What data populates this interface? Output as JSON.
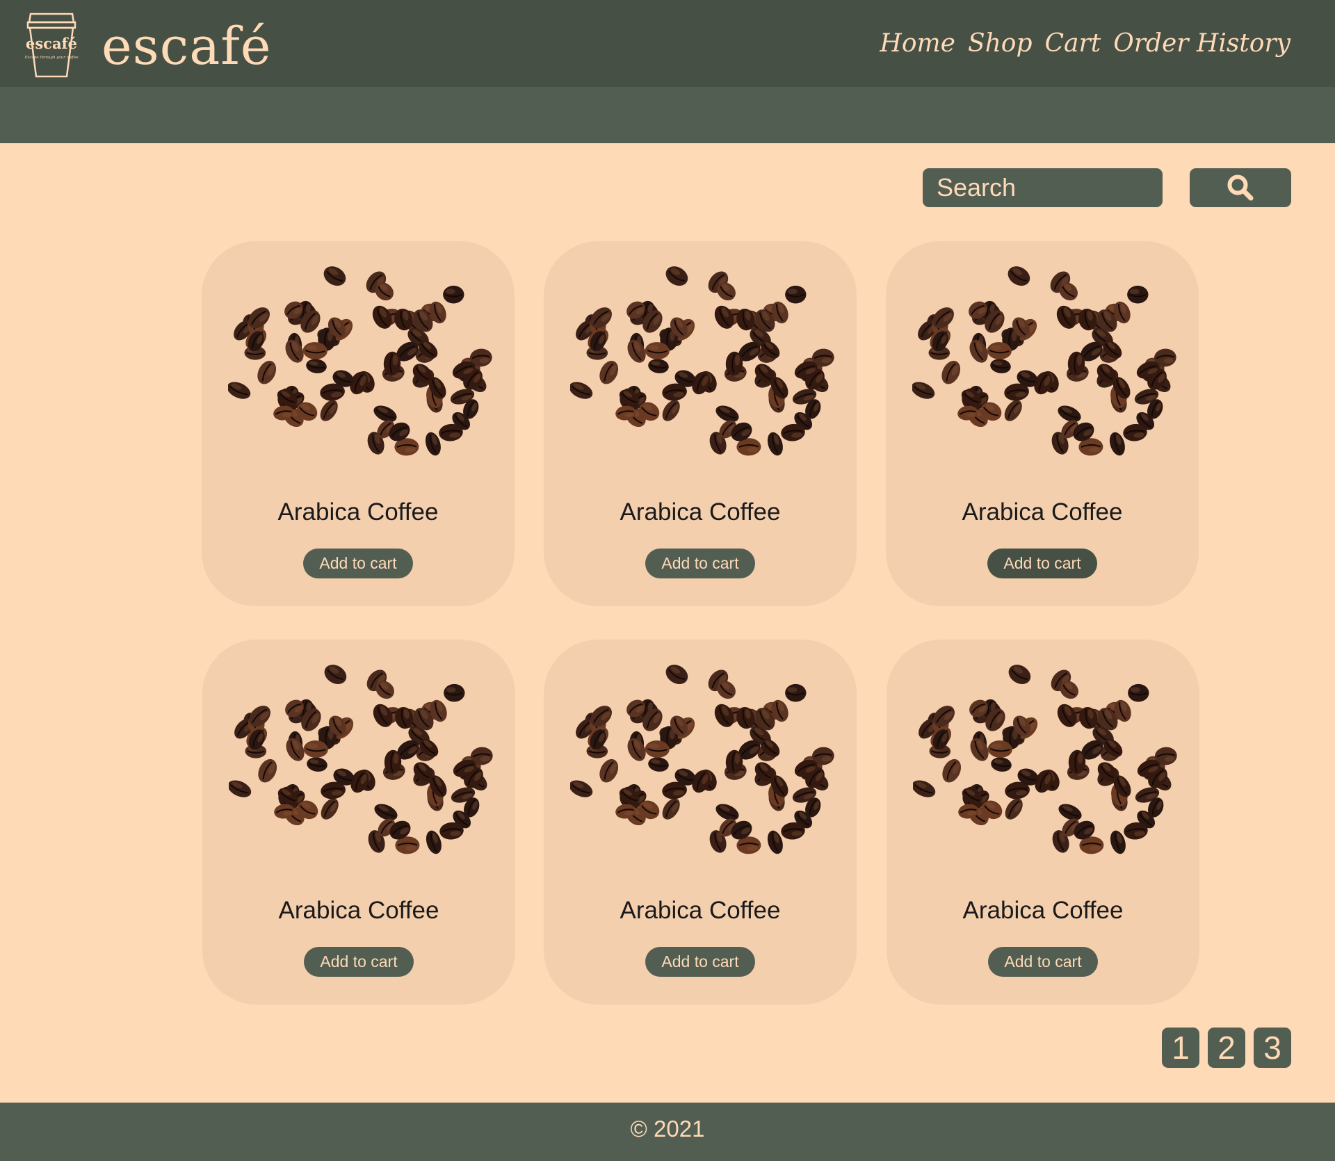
{
  "header": {
    "logo_text": "escafé",
    "logo_tagline": "Escape through your coffee",
    "brand": "escafé",
    "nav": [
      "Home",
      "Shop",
      "Cart",
      "Order History"
    ]
  },
  "search": {
    "placeholder": "Search",
    "value": "",
    "icon": "search-icon"
  },
  "products": [
    {
      "name": "Arabica Coffee",
      "button": "Add to cart",
      "image": "coffee-beans-image"
    },
    {
      "name": "Arabica Coffee",
      "button": "Add to cart",
      "image": "coffee-beans-image"
    },
    {
      "name": "Arabica Coffee",
      "button": "Add to cart",
      "image": "coffee-beans-image"
    },
    {
      "name": "Arabica Coffee",
      "button": "Add to cart",
      "image": "coffee-beans-image"
    },
    {
      "name": "Arabica Coffee",
      "button": "Add to cart",
      "image": "coffee-beans-image"
    },
    {
      "name": "Arabica Coffee",
      "button": "Add to cart",
      "image": "coffee-beans-image"
    }
  ],
  "pagination": [
    "1",
    "2",
    "3"
  ],
  "footer": {
    "text": "© 2021"
  },
  "colors": {
    "background": "#fedab7",
    "header": "#465045",
    "subheader": "#535e52",
    "card": "#f4cfae",
    "button": "#535e52",
    "button_text": "#fedab7"
  }
}
